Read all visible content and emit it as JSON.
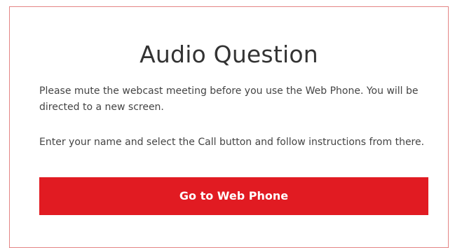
{
  "dialog": {
    "title": "Audio Question",
    "paragraph_1": "Please mute the webcast meeting before you use the Web Phone. You will be directed to a new screen.",
    "paragraph_2": "Enter your name and select the Call button and follow instructions from there.",
    "button_label": "Go to Web Phone"
  },
  "colors": {
    "accent": "#e11b22",
    "border": "#e48585",
    "text": "#333333"
  }
}
